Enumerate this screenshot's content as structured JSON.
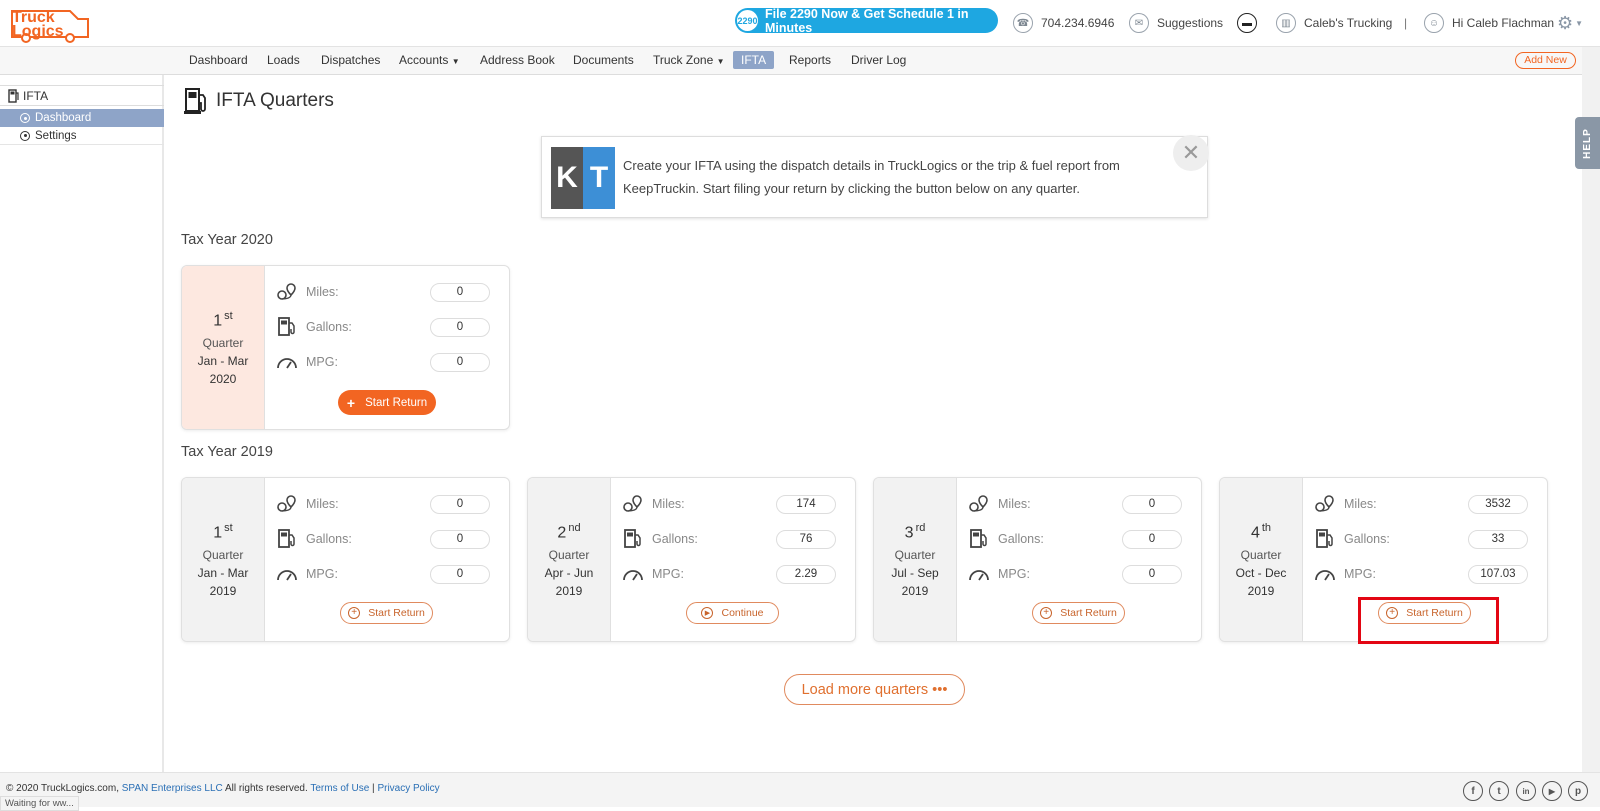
{
  "brand": {
    "logo_line1": "Truck",
    "logo_line2": "Logics",
    "color": "#f26522"
  },
  "topbar": {
    "promo_badge": "2290",
    "promo": "File 2290 Now & Get Schedule 1 in Minutes",
    "phone": "704.234.6946",
    "suggestions": "Suggestions",
    "company": "Caleb's Trucking",
    "separator": "|",
    "greeting": "Hi Caleb Flachman"
  },
  "nav": {
    "items": [
      "Dashboard",
      "Loads",
      "Dispatches",
      "Accounts",
      "Address Book",
      "Documents",
      "Truck Zone",
      "IFTA",
      "Reports",
      "Driver Log"
    ],
    "active": "IFTA",
    "add_new": "Add New"
  },
  "sidebar": {
    "section": "IFTA",
    "items": [
      "Dashboard",
      "Settings"
    ]
  },
  "page": {
    "title": "IFTA Quarters"
  },
  "banner": {
    "logo_left": "K",
    "logo_right": "T",
    "text": "Create your IFTA using the dispatch details in TruckLogics or the trip & fuel report from KeepTruckin. Start filing your return by clicking the button below on any quarter."
  },
  "labels": {
    "miles": "Miles:",
    "gallons": "Gallons:",
    "mpg": "MPG:",
    "quarter": "Quarter"
  },
  "years": [
    {
      "heading": "Tax Year 2020",
      "quarters": [
        {
          "num": "1",
          "suffix": "st",
          "range": "Jan - Mar",
          "year": "2020",
          "miles": "0",
          "gallons": "0",
          "mpg": "0",
          "action": "Start Return"
        }
      ]
    },
    {
      "heading": "Tax Year 2019",
      "quarters": [
        {
          "num": "1",
          "suffix": "st",
          "range": "Jan - Mar",
          "year": "2019",
          "miles": "0",
          "gallons": "0",
          "mpg": "0",
          "action": "Start Return"
        },
        {
          "num": "2",
          "suffix": "nd",
          "range": "Apr - Jun",
          "year": "2019",
          "miles": "174",
          "gallons": "76",
          "mpg": "2.29",
          "action": "Continue"
        },
        {
          "num": "3",
          "suffix": "rd",
          "range": "Jul - Sep",
          "year": "2019",
          "miles": "0",
          "gallons": "0",
          "mpg": "0",
          "action": "Start Return"
        },
        {
          "num": "4",
          "suffix": "th",
          "range": "Oct - Dec",
          "year": "2019",
          "miles": "3532",
          "gallons": "33",
          "mpg": "107.03",
          "action": "Start Return"
        }
      ]
    }
  ],
  "load_more": "Load more quarters •••",
  "help": "HELP",
  "footer": {
    "copyright": "© 2020 TruckLogics.com, ",
    "company": "SPAN Enterprises LLC",
    "rights": " All rights reserved. ",
    "terms": "Terms of Use",
    "sep": " | ",
    "privacy": "Privacy Policy",
    "status": "Waiting for ww...",
    "social": [
      "f",
      "t",
      "in",
      "▶",
      "p"
    ]
  }
}
